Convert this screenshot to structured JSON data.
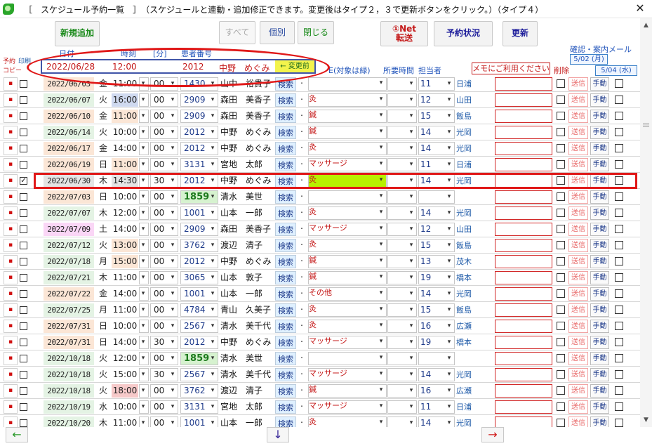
{
  "window": {
    "title": "［　スケジュール予約一覧　］　（スケジュールと連動・追加修正できます。変更後はタイプ２，３で更新ボタンをクリック。）（タイプ４）",
    "close": "✕"
  },
  "toolbar": {
    "add": "新規追加",
    "all": "すべて",
    "individual": "個別",
    "close": "閉じる",
    "net_send_line1": "①Net",
    "net_send_line2": "転送",
    "status": "予約状況",
    "update": "更新"
  },
  "headers": {
    "reserve": "予約",
    "print": "印刷",
    "copy": "コピー",
    "date": "日付",
    "time": "時刻",
    "minute": "[分]",
    "patient_no": "患者番号",
    "treatment": "E(対象は緑)",
    "duration": "所要時間",
    "staff": "担当者",
    "confirm_mail": "確認・案内メール",
    "memo_hint": "メモにご利用ください",
    "delete": "削除",
    "date1": "5/02 (月)",
    "date2": "5/04 (水)"
  },
  "current": {
    "date": "2022/06/28",
    "time": "12:00",
    "patient_no": "2012",
    "name": "中野　めぐみ",
    "prev_button": "← 変更前"
  },
  "labels": {
    "search": "検索",
    "send": "送信",
    "manual": "手動",
    "mark": "▪",
    "dot": "･",
    "check": "✓",
    "dropdown": "▾"
  },
  "rows": [
    {
      "date": "2022/06/03",
      "dow": "金",
      "time": "11:00",
      "min": "00",
      "pid": "1430",
      "name": "山中　裕貴子",
      "treat": "",
      "staff": "11",
      "stname": "日浦",
      "dbg": "#fbe6d6",
      "tbg": "#ffffff",
      "checked": false,
      "hl": false
    },
    {
      "date": "2022/06/07",
      "dow": "火",
      "time": "16:00",
      "min": "00",
      "pid": "2909",
      "name": "森田　美香子",
      "treat": "灸",
      "staff": "12",
      "stname": "山田",
      "dbg": "#e4f3e4",
      "tbg": "#cfd9ef",
      "checked": false,
      "hl": false
    },
    {
      "date": "2022/06/10",
      "dow": "金",
      "time": "11:00",
      "min": "00",
      "pid": "2909",
      "name": "森田　美香子",
      "treat": "鍼",
      "staff": "15",
      "stname": "飯島",
      "dbg": "#fbe6d6",
      "tbg": "#fbe6d6",
      "checked": false,
      "hl": false
    },
    {
      "date": "2022/06/14",
      "dow": "火",
      "time": "10:00",
      "min": "00",
      "pid": "2012",
      "name": "中野　めぐみ",
      "treat": "鍼",
      "staff": "14",
      "stname": "光岡",
      "dbg": "#e4f3e4",
      "tbg": "#ffffff",
      "checked": false,
      "hl": false
    },
    {
      "date": "2022/06/17",
      "dow": "金",
      "time": "14:00",
      "min": "00",
      "pid": "2012",
      "name": "中野　めぐみ",
      "treat": "灸",
      "staff": "14",
      "stname": "光岡",
      "dbg": "#fbe6d6",
      "tbg": "#ffffff",
      "checked": false,
      "hl": false
    },
    {
      "date": "2022/06/19",
      "dow": "日",
      "time": "11:00",
      "min": "00",
      "pid": "3131",
      "name": "宮地　太郎",
      "treat": "マッサージ",
      "staff": "11",
      "stname": "日浦",
      "dbg": "#fbe6d6",
      "tbg": "#fbe6d6",
      "checked": false,
      "hl": false
    },
    {
      "date": "2022/06/30",
      "dow": "木",
      "time": "14:30",
      "min": "30",
      "pid": "2012",
      "name": "中野　めぐみ",
      "treat": "灸",
      "staff": "14",
      "stname": "光岡",
      "dbg": "#e4e4e4",
      "tbg": "#e4e4e4",
      "checked": true,
      "hl": false,
      "treat_bg": "#b8f000"
    },
    {
      "date": "2022/07/03",
      "dow": "日",
      "time": "10:00",
      "min": "00",
      "pid": "1859",
      "name": "清水　美世",
      "treat": "",
      "staff": "",
      "stname": "",
      "dbg": "#fbe6d6",
      "tbg": "#ffffff",
      "checked": false,
      "hl": true
    },
    {
      "date": "2022/07/07",
      "dow": "木",
      "time": "12:00",
      "min": "00",
      "pid": "1001",
      "name": "山本　一郎",
      "treat": "灸",
      "staff": "14",
      "stname": "光岡",
      "dbg": "#e4f3e4",
      "tbg": "#ffffff",
      "checked": false,
      "hl": false
    },
    {
      "date": "2022/07/09",
      "dow": "土",
      "time": "14:00",
      "min": "00",
      "pid": "2909",
      "name": "森田　美香子",
      "treat": "マッサージ",
      "staff": "12",
      "stname": "山田",
      "dbg": "#fad6f6",
      "tbg": "#ffffff",
      "checked": false,
      "hl": false
    },
    {
      "date": "2022/07/12",
      "dow": "火",
      "time": "13:00",
      "min": "00",
      "pid": "3762",
      "name": "渡辺　清子",
      "treat": "灸",
      "staff": "15",
      "stname": "飯島",
      "dbg": "#e4f3e4",
      "tbg": "#fbe6d6",
      "checked": false,
      "hl": false
    },
    {
      "date": "2022/07/18",
      "dow": "月",
      "time": "15:00",
      "min": "00",
      "pid": "2012",
      "name": "中野　めぐみ",
      "treat": "鍼",
      "staff": "13",
      "stname": "茂木",
      "dbg": "#e4f3e4",
      "tbg": "#fbe6d6",
      "checked": false,
      "hl": false
    },
    {
      "date": "2022/07/21",
      "dow": "木",
      "time": "11:00",
      "min": "00",
      "pid": "3065",
      "name": "山本　敦子",
      "treat": "鍼",
      "staff": "19",
      "stname": "橋本",
      "dbg": "#e4f3e4",
      "tbg": "#ffffff",
      "checked": false,
      "hl": false
    },
    {
      "date": "2022/07/22",
      "dow": "金",
      "time": "14:00",
      "min": "00",
      "pid": "1001",
      "name": "山本　一郎",
      "treat": "その他",
      "staff": "14",
      "stname": "光岡",
      "dbg": "#fbe6d6",
      "tbg": "#ffffff",
      "checked": false,
      "hl": false
    },
    {
      "date": "2022/07/25",
      "dow": "月",
      "time": "11:00",
      "min": "00",
      "pid": "4784",
      "name": "青山　久美子",
      "treat": "灸",
      "staff": "15",
      "stname": "飯島",
      "dbg": "#e4f3e4",
      "tbg": "#ffffff",
      "checked": false,
      "hl": false
    },
    {
      "date": "2022/07/31",
      "dow": "日",
      "time": "10:00",
      "min": "00",
      "pid": "2567",
      "name": "清水　美千代",
      "treat": "灸",
      "staff": "16",
      "stname": "広瀬",
      "dbg": "#fbe6d6",
      "tbg": "#ffffff",
      "checked": false,
      "hl": false
    },
    {
      "date": "2022/07/31",
      "dow": "日",
      "time": "14:00",
      "min": "30",
      "pid": "2012",
      "name": "中野　めぐみ",
      "treat": "マッサージ",
      "staff": "19",
      "stname": "橋本",
      "dbg": "#fbe6d6",
      "tbg": "#ffffff",
      "checked": false,
      "hl": false
    },
    {
      "date": "2022/10/18",
      "dow": "火",
      "time": "12:00",
      "min": "00",
      "pid": "1859",
      "name": "清水　美世",
      "treat": "",
      "staff": "",
      "stname": "",
      "dbg": "#e4f3e4",
      "tbg": "#ffffff",
      "checked": false,
      "hl": true
    },
    {
      "date": "2022/10/18",
      "dow": "火",
      "time": "15:00",
      "min": "30",
      "pid": "2567",
      "name": "清水　美千代",
      "treat": "マッサージ",
      "staff": "14",
      "stname": "光岡",
      "dbg": "#e4f3e4",
      "tbg": "#ffffff",
      "checked": false,
      "hl": false
    },
    {
      "date": "2022/10/18",
      "dow": "火",
      "time": "18:00",
      "min": "00",
      "pid": "3762",
      "name": "渡辺　清子",
      "treat": "鍼",
      "staff": "16",
      "stname": "広瀬",
      "dbg": "#e4f3e4",
      "tbg": "#f6c9c9",
      "checked": false,
      "hl": false
    },
    {
      "date": "2022/10/19",
      "dow": "水",
      "time": "10:00",
      "min": "00",
      "pid": "3131",
      "name": "宮地　太郎",
      "treat": "マッサージ",
      "staff": "11",
      "stname": "日浦",
      "dbg": "#e4f3e4",
      "tbg": "#ffffff",
      "checked": false,
      "hl": false
    },
    {
      "date": "2022/10/20",
      "dow": "木",
      "time": "11:00",
      "min": "00",
      "pid": "1001",
      "name": "山本　一郎",
      "treat": "灸",
      "staff": "14",
      "stname": "光岡",
      "dbg": "#e4f3e4",
      "tbg": "#ffffff",
      "checked": false,
      "hl": false
    }
  ],
  "nav": {
    "left": "←",
    "down": "↓",
    "right": "→"
  },
  "scroll": {
    "up": "▲",
    "down": "▼"
  }
}
